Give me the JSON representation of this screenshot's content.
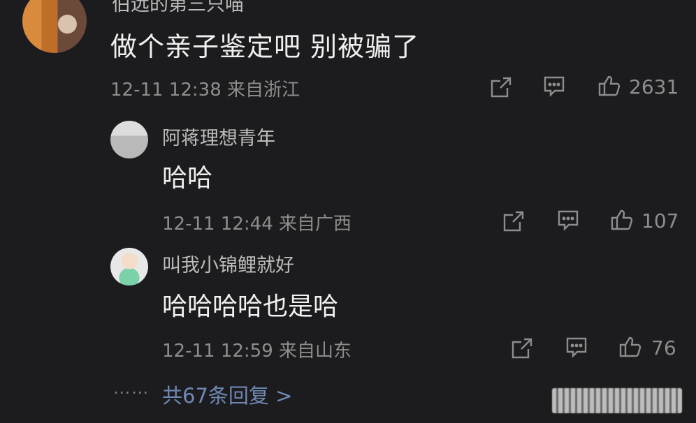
{
  "comment": {
    "user": "伯远的第三只喵",
    "content": "做个亲子鉴定吧 别被骗了",
    "time": "12-11 12:38 来自浙江",
    "likes": "2631"
  },
  "replies": [
    {
      "user": "阿蒋理想青年",
      "content": "哈哈",
      "time": "12-11 12:44 来自广西",
      "likes": "107"
    },
    {
      "user": "叫我小锦鲤就好",
      "content": "哈哈哈哈也是哈",
      "time": "12-11 12:59 来自山东",
      "likes": "76"
    }
  ],
  "more_replies": "共67条回复 >",
  "more_dots": "⋯⋯",
  "icons": [
    "share-icon",
    "comment-icon",
    "like-icon"
  ],
  "colors": {
    "background": "#1c1c1e",
    "link": "#6f88b4",
    "meta": "#8d8d8d"
  }
}
